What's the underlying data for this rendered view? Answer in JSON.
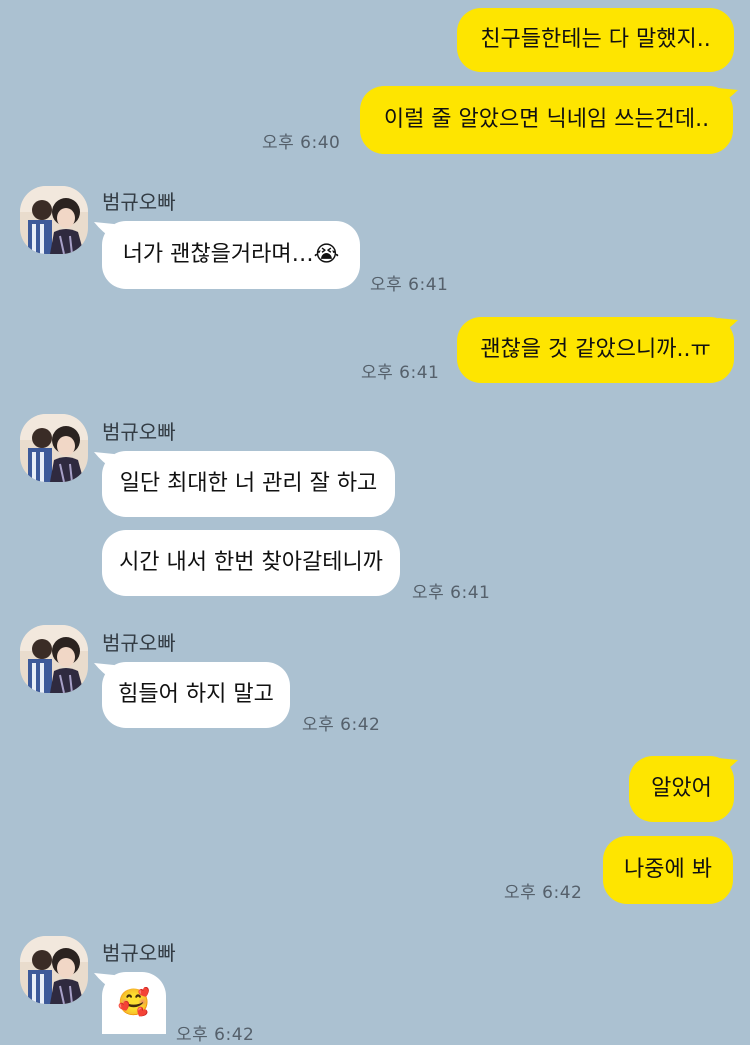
{
  "messages": {
    "m1": "친구들한테는 다 말했지..",
    "m2": "이럴 줄 알았으면 닉네임 쓰는건데..",
    "t1": "오후 6:40",
    "name1": "범규오빠",
    "m3": "너가 괜찮을거라며…😭",
    "t2": "오후 6:41",
    "m4": "괜찮을 것 같았으니까..ㅠ",
    "t3": "오후 6:41",
    "name2": "범규오빠",
    "m5": "일단 최대한 너 관리 잘 하고",
    "m6": "시간 내서 한번 찾아갈테니까",
    "t4": "오후 6:41",
    "name3": "범규오빠",
    "m7": "힘들어 하지 말고",
    "t5": "오후 6:42",
    "m8": "알았어",
    "m9": "나중에 봐",
    "t6": "오후 6:42",
    "name4": "범규오빠",
    "m10": "🥰",
    "t7": "오후 6:42"
  },
  "colors": {
    "background": "#abc1d1",
    "my_bubble": "#fee500",
    "their_bubble": "#ffffff"
  },
  "icons": {
    "avatar": "profile-photo"
  }
}
